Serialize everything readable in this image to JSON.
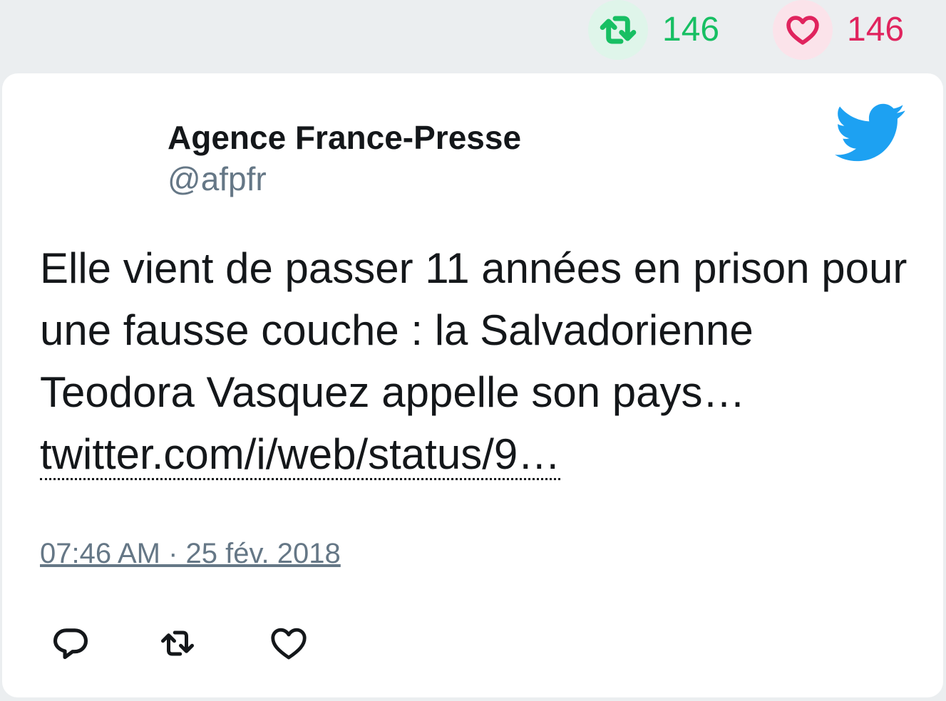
{
  "stats": {
    "retweet_count": "146",
    "like_count": "146"
  },
  "tweet": {
    "author_name": "Agence France-Presse",
    "author_handle": "@afpfr",
    "text": "Elle vient de passer 11 années en prison pour une fausse couche : la Salvadorienne Teodora Vasquez appelle son pays…",
    "link_text": "twitter.com/i/web/status/9…",
    "timestamp": "07:46 AM · 25 fév. 2018"
  },
  "icons": {
    "brand": "twitter-bird-icon",
    "retweet": "retweet-icon",
    "like": "heart-icon",
    "reply": "reply-icon"
  },
  "colors": {
    "background": "#ebeef0",
    "card": "#ffffff",
    "text": "#14171a",
    "muted": "#657786",
    "twitter_blue": "#1da1f2",
    "retweet_green": "#17bf63",
    "like_red": "#e0245e"
  }
}
